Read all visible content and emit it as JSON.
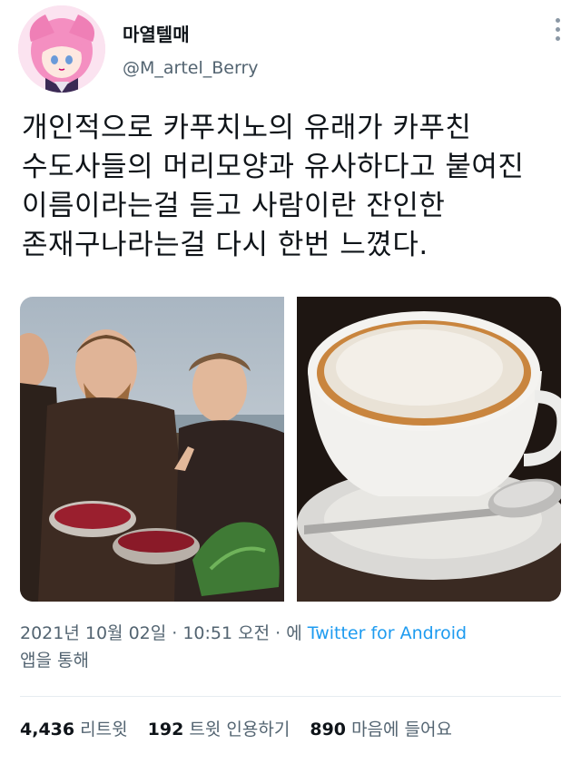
{
  "user": {
    "display_name": "마열텔매",
    "handle": "@M_artel_Berry"
  },
  "tweet": {
    "lines": [
      "개인적으로 카푸치노의 유래가 카푸친",
      "수도사들의 머리모양과 유사하다고 붙여진",
      "이름이라는걸 듣고 사람이란 잔인한",
      "존재구나라는걸 다시 한번 느꼈다."
    ]
  },
  "media": {
    "left_icon": "monks-painting-image",
    "right_icon": "cappuccino-cup-image"
  },
  "meta": {
    "timestamp": "2021년 10월 02일 · 10:51 오전 · 에 ",
    "source": "Twitter for Android",
    "suffix": "앱을 통해"
  },
  "stats": {
    "retweets_count": "4,436",
    "retweets_label": "리트윗",
    "quotes_count": "192",
    "quotes_label": "트윗 인용하기",
    "likes_count": "890",
    "likes_label": "마음에 들어요"
  },
  "colors": {
    "link": "#1d9bf0",
    "muted": "#536471",
    "text": "#0f1419"
  }
}
